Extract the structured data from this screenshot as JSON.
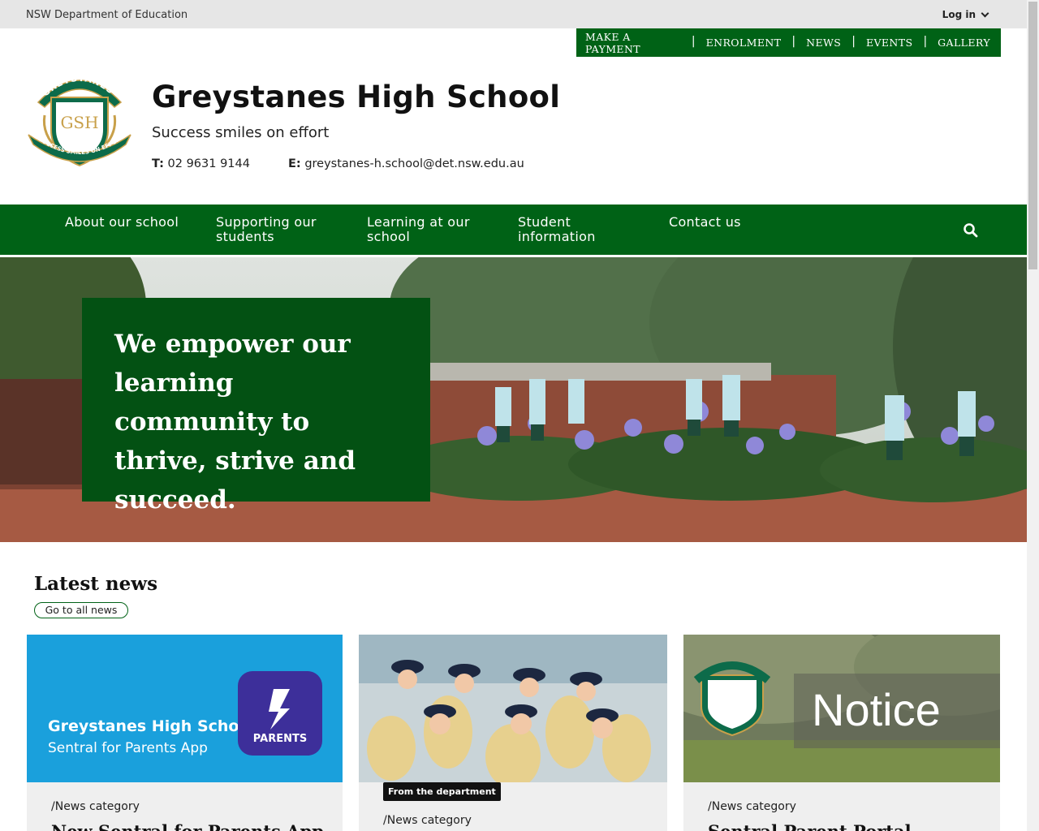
{
  "utility": {
    "department": "NSW Department of Education",
    "login": "Log in"
  },
  "quick_links": [
    "MAKE A PAYMENT",
    "ENROLMENT",
    "NEWS",
    "EVENTS",
    "GALLERY"
  ],
  "header": {
    "school_name": "Greystanes High School",
    "motto": "Success smiles on effort",
    "phone_label": "T:",
    "phone": "02 9631 9144",
    "email_label": "E:",
    "email": "greystanes-h.school@det.nsw.edu.au",
    "crest_text_top": "GREYSTANES",
    "crest_text_bottom": "SUCCESS SMILES ON EFFORT",
    "crest_monogram": "GSH"
  },
  "nav": [
    "About our school",
    "Supporting our students",
    "Learning at our school",
    "Student information",
    "Contact us"
  ],
  "hero": {
    "text": "We empower our learning community to thrive, strive and succeed."
  },
  "news": {
    "title": "Latest news",
    "all_link": "Go to all news",
    "cards": [
      {
        "image_title": "Greystanes High School",
        "image_subtitle": "Sentral for Parents App",
        "image_badge": "PARENTS",
        "category": "/News category",
        "headline": "New Sentral for Parents App"
      },
      {
        "tag": "From the department",
        "category": "/News category",
        "headline": ""
      },
      {
        "image_word": "Notice",
        "category": "/News category",
        "headline": "Sentral Parent Portal"
      }
    ]
  },
  "colors": {
    "brand_green": "#006216",
    "hero_box": "#035113",
    "sentral_blue": "#1aa0dc"
  }
}
